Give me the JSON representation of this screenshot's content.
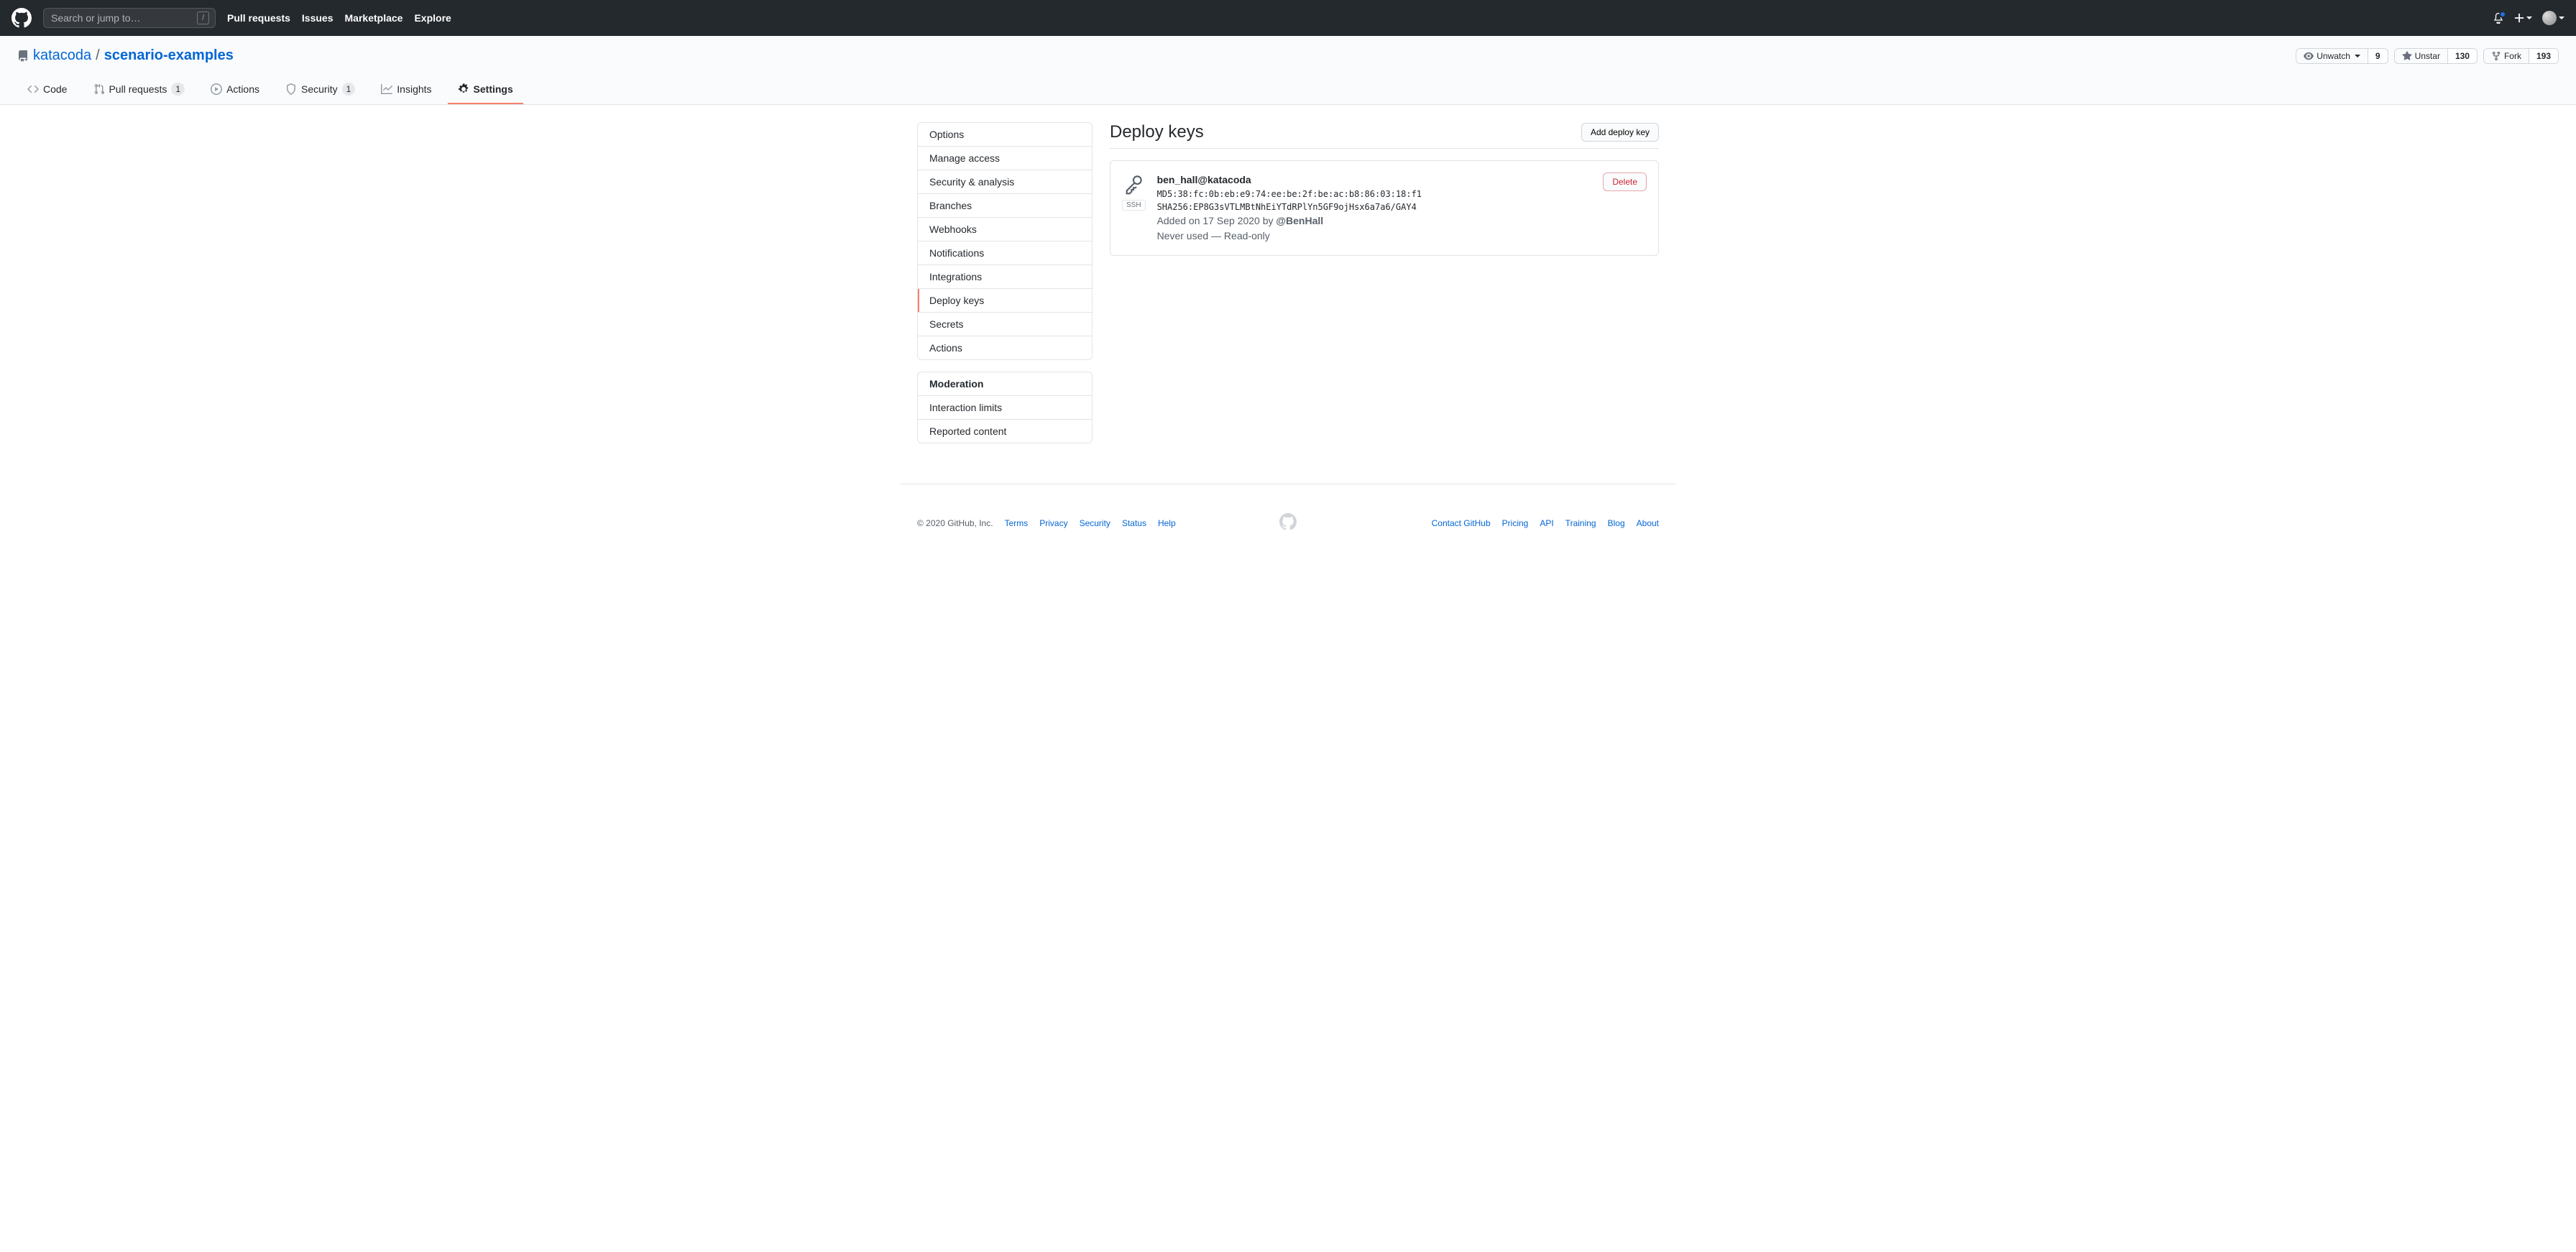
{
  "search": {
    "placeholder": "Search or jump to…",
    "hotkey": "/"
  },
  "topnav": {
    "pull_requests": "Pull requests",
    "issues": "Issues",
    "marketplace": "Marketplace",
    "explore": "Explore"
  },
  "repo": {
    "owner": "katacoda",
    "separator": "/",
    "name": "scenario-examples"
  },
  "actions": {
    "watch": {
      "label": "Unwatch",
      "count": "9"
    },
    "star": {
      "label": "Unstar",
      "count": "130"
    },
    "fork": {
      "label": "Fork",
      "count": "193"
    }
  },
  "tabs": {
    "code": "Code",
    "pulls": "Pull requests",
    "pulls_count": "1",
    "actions": "Actions",
    "security": "Security",
    "security_count": "1",
    "insights": "Insights",
    "settings": "Settings"
  },
  "sidebar": {
    "items": [
      "Options",
      "Manage access",
      "Security & analysis",
      "Branches",
      "Webhooks",
      "Notifications",
      "Integrations",
      "Deploy keys",
      "Secrets",
      "Actions"
    ],
    "moderation_heading": "Moderation",
    "moderation_items": [
      "Interaction limits",
      "Reported content"
    ]
  },
  "page": {
    "title": "Deploy keys",
    "add_button": "Add deploy key"
  },
  "key": {
    "ssh_label": "SSH",
    "title": "ben_hall@katacoda",
    "md5": "MD5:38:fc:0b:eb:e9:74:ee:be:2f:be:ac:b8:86:03:18:f1",
    "sha": "SHA256:EP8G3sVTLMBtNhEiYTdRPlYn5GF9ojHsx6a7a6/GAY4",
    "added_prefix": "Added on 17 Sep 2020 by ",
    "added_by": "@BenHall",
    "status": "Never used — Read-only",
    "delete": "Delete"
  },
  "footer": {
    "copyright": "© 2020 GitHub, Inc.",
    "left": [
      "Terms",
      "Privacy",
      "Security",
      "Status",
      "Help"
    ],
    "right": [
      "Contact GitHub",
      "Pricing",
      "API",
      "Training",
      "Blog",
      "About"
    ]
  }
}
